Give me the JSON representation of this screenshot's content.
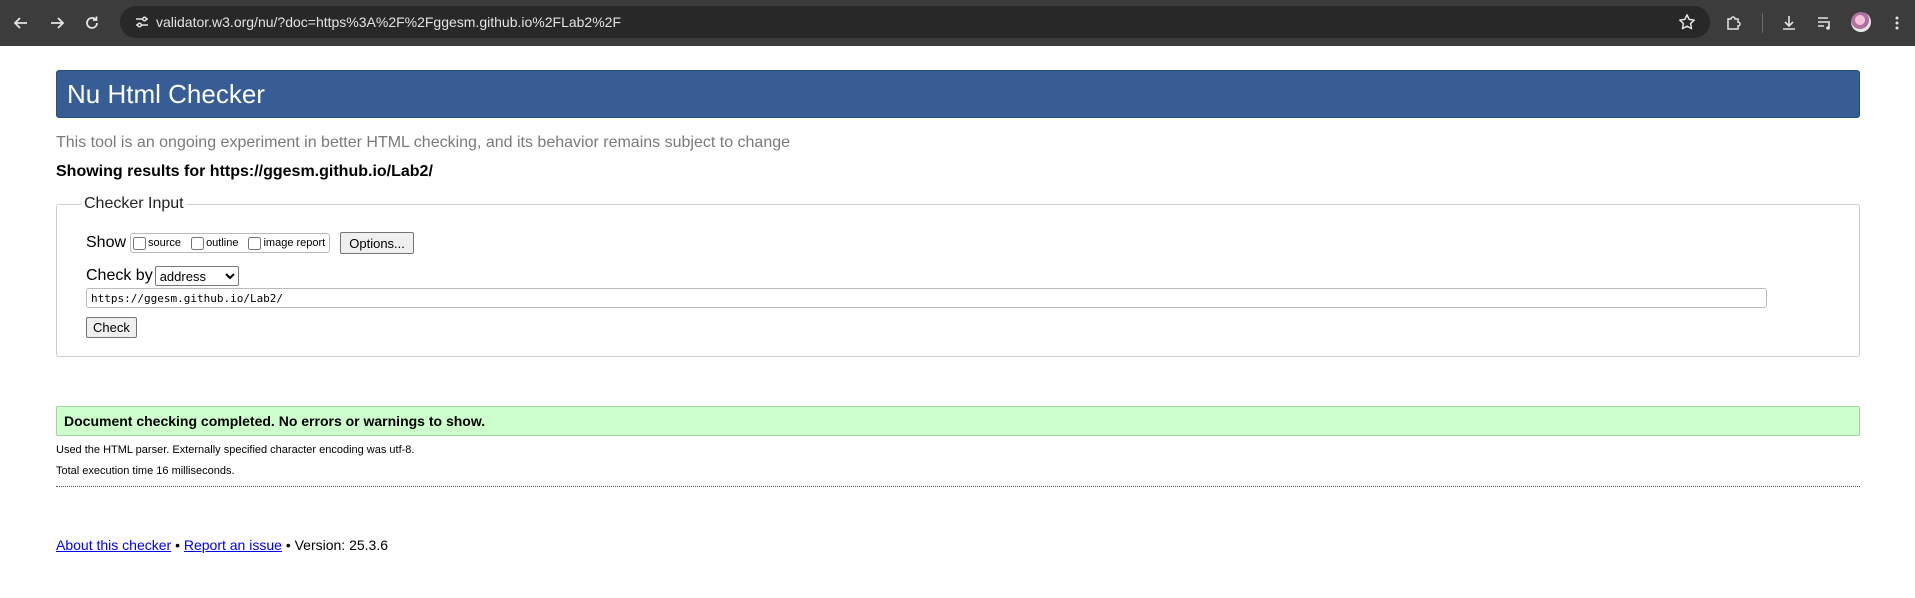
{
  "browser": {
    "url": "validator.w3.org/nu/?doc=https%3A%2F%2Fggesm.github.io%2FLab2%2F"
  },
  "page": {
    "title": "Nu Html Checker",
    "tagline": "This tool is an ongoing experiment in better HTML checking, and its behavior remains subject to change",
    "showing": "Showing results for https://ggesm.github.io/Lab2/"
  },
  "checker": {
    "legend": "Checker Input",
    "show_label": "Show",
    "options": [
      {
        "label": "source",
        "checked": false
      },
      {
        "label": "outline",
        "checked": false
      },
      {
        "label": "image report",
        "checked": false
      }
    ],
    "options_button": "Options...",
    "check_by_label": "Check by",
    "check_by_selected": "address",
    "url_value": "https://ggesm.github.io/Lab2/",
    "check_button": "Check"
  },
  "results": {
    "success": "Document checking completed. No errors or warnings to show.",
    "parser_info": "Used the HTML parser. Externally specified character encoding was utf-8.",
    "exec_time": "Total execution time 16 milliseconds."
  },
  "footer": {
    "about": "About this checker",
    "bullet": "•",
    "report": "Report an issue",
    "version": "• Version: 25.3.6"
  },
  "colors": {
    "banner": "#365d95",
    "success_bg": "#ccffcc",
    "chrome_bg": "#3c3c3c"
  }
}
